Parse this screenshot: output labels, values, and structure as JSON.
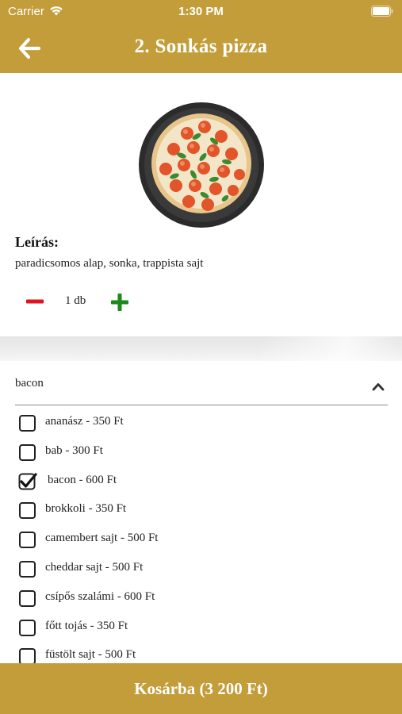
{
  "status": {
    "carrier": "Carrier",
    "time": "1:30 PM"
  },
  "header": {
    "title": "2. Sonkás pizza",
    "back_icon": "arrow-left-icon"
  },
  "product": {
    "description_heading": "Leírás:",
    "description": "paradicsomos alap, sonka, trappista sajt",
    "quantity": "1 db",
    "minus_color": "#e0141e",
    "plus_color": "#1a8a1a"
  },
  "toppings": {
    "selected": "bacon",
    "options": [
      {
        "label": "ananász - 350 Ft",
        "checked": false
      },
      {
        "label": "bab - 300 Ft",
        "checked": false
      },
      {
        "label": "bacon - 600 Ft",
        "checked": true
      },
      {
        "label": "brokkoli - 350 Ft",
        "checked": false
      },
      {
        "label": "camembert sajt - 500 Ft",
        "checked": false
      },
      {
        "label": "cheddar sajt - 500 Ft",
        "checked": false
      },
      {
        "label": "csípős szalámi - 600 Ft",
        "checked": false
      },
      {
        "label": "főtt tojás - 350 Ft",
        "checked": false
      },
      {
        "label": "füstölt sajt - 500 Ft",
        "checked": false
      }
    ]
  },
  "cart": {
    "label": "Kosárba (3 200 Ft)"
  },
  "colors": {
    "accent": "#c29d39",
    "text": "#111111"
  }
}
